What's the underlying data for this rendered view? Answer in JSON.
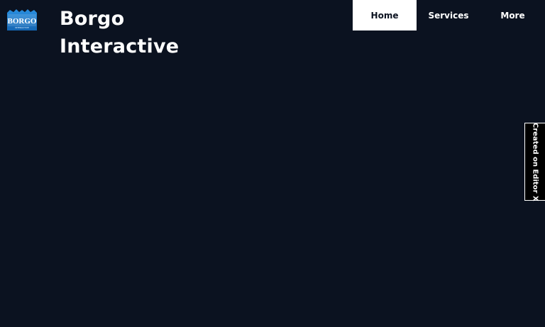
{
  "header": {
    "logo_name": "BORGO",
    "logo_sub": "INTERACTIVE",
    "title_line1": "Borgo",
    "title_line2": "Interactive"
  },
  "nav": {
    "items": [
      {
        "label": "Home",
        "active": true
      },
      {
        "label": "Services",
        "active": false
      },
      {
        "label": "More",
        "active": false
      }
    ]
  },
  "badge": {
    "label": "Created on Editor X"
  },
  "colors": {
    "background": "#0b1220",
    "logo_blue": "#1e7fd0",
    "nav_active_bg": "#ffffff"
  }
}
